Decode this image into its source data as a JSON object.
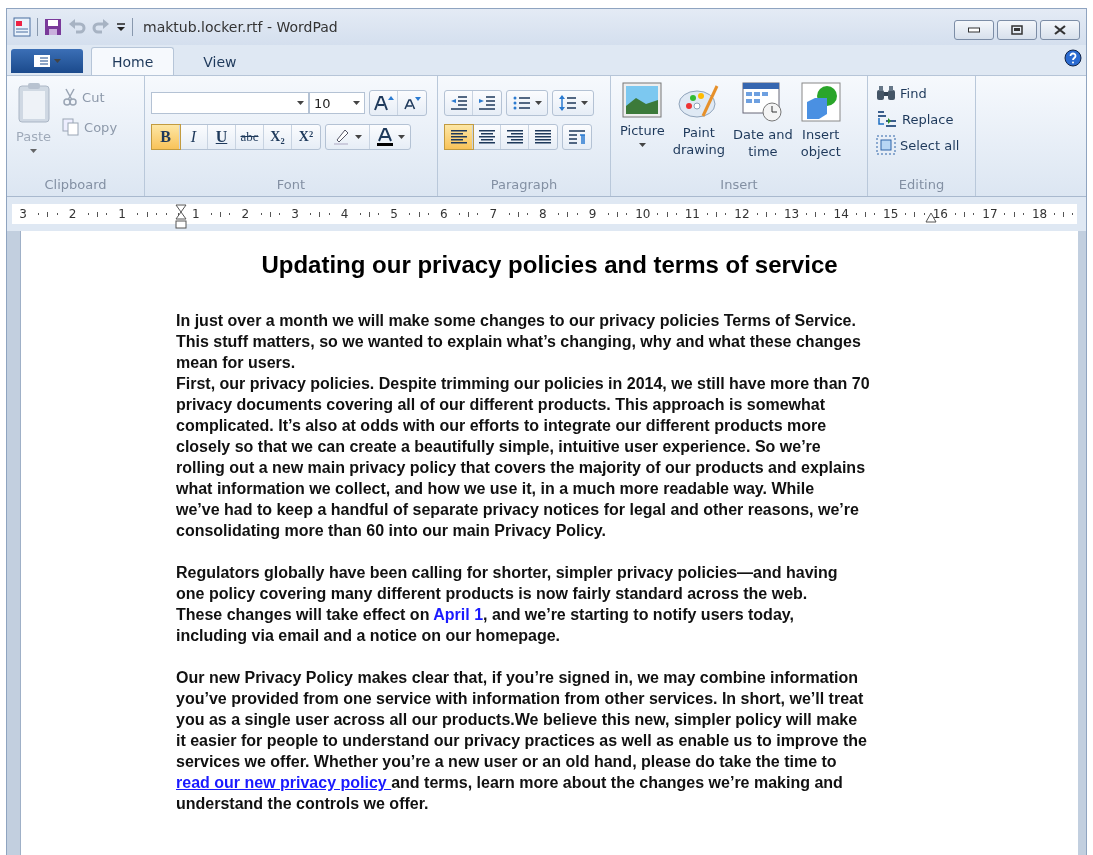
{
  "window": {
    "title": "maktub.locker.rtf - WordPad"
  },
  "tabs": [
    {
      "label": "Home",
      "selected": true
    },
    {
      "label": "View",
      "selected": false
    }
  ],
  "ribbon": {
    "clipboard": {
      "label": "Clipboard",
      "paste": {
        "label": "Paste",
        "disabled": true
      },
      "items": [
        {
          "kind": "cut",
          "label": "Cut",
          "disabled": true
        },
        {
          "kind": "copy",
          "label": "Copy",
          "disabled": true
        }
      ]
    },
    "font": {
      "label": "Font",
      "size": "10",
      "format_buttons": [
        {
          "kind": "bold",
          "label": "B",
          "selected": true
        },
        {
          "kind": "italic",
          "label": "I",
          "selected": false
        },
        {
          "kind": "underline",
          "label": "U",
          "selected": false
        },
        {
          "kind": "strike",
          "label": "abc",
          "selected": false
        },
        {
          "kind": "sub",
          "label": "X₂",
          "selected": false
        },
        {
          "kind": "sup",
          "label": "X²",
          "selected": false
        }
      ]
    },
    "paragraph": {
      "label": "Paragraph",
      "align_buttons": [
        {
          "kind": "left",
          "selected": true
        },
        {
          "kind": "center",
          "selected": false
        },
        {
          "kind": "right",
          "selected": false
        },
        {
          "kind": "justify",
          "selected": false
        }
      ]
    },
    "insert": {
      "label": "Insert",
      "items": [
        {
          "kind": "picture",
          "label": "Picture",
          "dropdown": true
        },
        {
          "kind": "paint",
          "label": "Paint\ndrawing",
          "dropdown": false
        },
        {
          "kind": "datetime",
          "label": "Date and\ntime",
          "dropdown": false
        },
        {
          "kind": "object",
          "label": "Insert\nobject",
          "dropdown": false
        }
      ]
    },
    "editing": {
      "label": "Editing",
      "items": [
        {
          "kind": "find",
          "label": "Find"
        },
        {
          "kind": "replace",
          "label": "Replace"
        },
        {
          "kind": "selectall",
          "label": "Select all"
        }
      ]
    }
  },
  "ruler": {
    "left_labels": [
      "3",
      "2",
      "1"
    ],
    "right_labels": [
      "1",
      "2",
      "3",
      "4",
      "5",
      "6",
      "7",
      "8",
      "9",
      "10",
      "11",
      "12",
      "13",
      "14",
      "15",
      "16",
      "17",
      "18"
    ]
  },
  "document": {
    "title": "Updating our privacy policies and terms of service",
    "paragraphs": [
      {
        "gap_before": false,
        "segments": [
          {
            "text": "In just over a month we will make some changes to our privacy policies Terms of Service.\nThis stuff matters, so we wanted to explain what’s changing, why and what these changes\nmean for users."
          }
        ]
      },
      {
        "gap_before": false,
        "segments": [
          {
            "text": "First, our privacy policies. Despite trimming our policies in 2014, we still have more than 70\nprivacy documents covering all of our different products. This approach is somewhat\ncomplicated. It’s also at odds with our efforts to integrate our different products more\nclosely so that we can create a beautifully simple, intuitive user experience. So we’re\nrolling out a new main privacy policy that covers the majority of our products and explains\nwhat information we collect, and how we use it, in a much more readable way. While\nwe’ve had to keep a handful of separate privacy notices for legal and other reasons, we’re\nconsolidating more than 60 into our main Privacy Policy."
          }
        ]
      },
      {
        "gap_before": true,
        "segments": [
          {
            "text": "Regulators globally have been calling for shorter, simpler privacy policies—and having\none policy covering many different products is now fairly standard across the web.\nThese changes will take effect on "
          },
          {
            "text": "April 1",
            "kind": "link",
            "underline": false
          },
          {
            "text": ", and we’re starting to notify users today,\nincluding via email and a notice on our homepage."
          }
        ]
      },
      {
        "gap_before": true,
        "segments": [
          {
            "text": "Our new Privacy Policy makes clear that, if you’re signed in, we may combine information\nyou’ve provided from one service with information from other services. In short, we’ll treat\nyou as a single user across all our products.We believe this new, simpler policy will make\nit easier for people to understand our privacy practices as well as enable us to improve the\nservices we offer. Whether you’re a new user or an old hand, please do take the time to\n"
          },
          {
            "text": "read our new privacy policy ",
            "kind": "link",
            "underline": true
          },
          {
            "text": "and terms, learn more about the changes we’re making and\nunderstand the controls we offer."
          }
        ]
      }
    ]
  }
}
